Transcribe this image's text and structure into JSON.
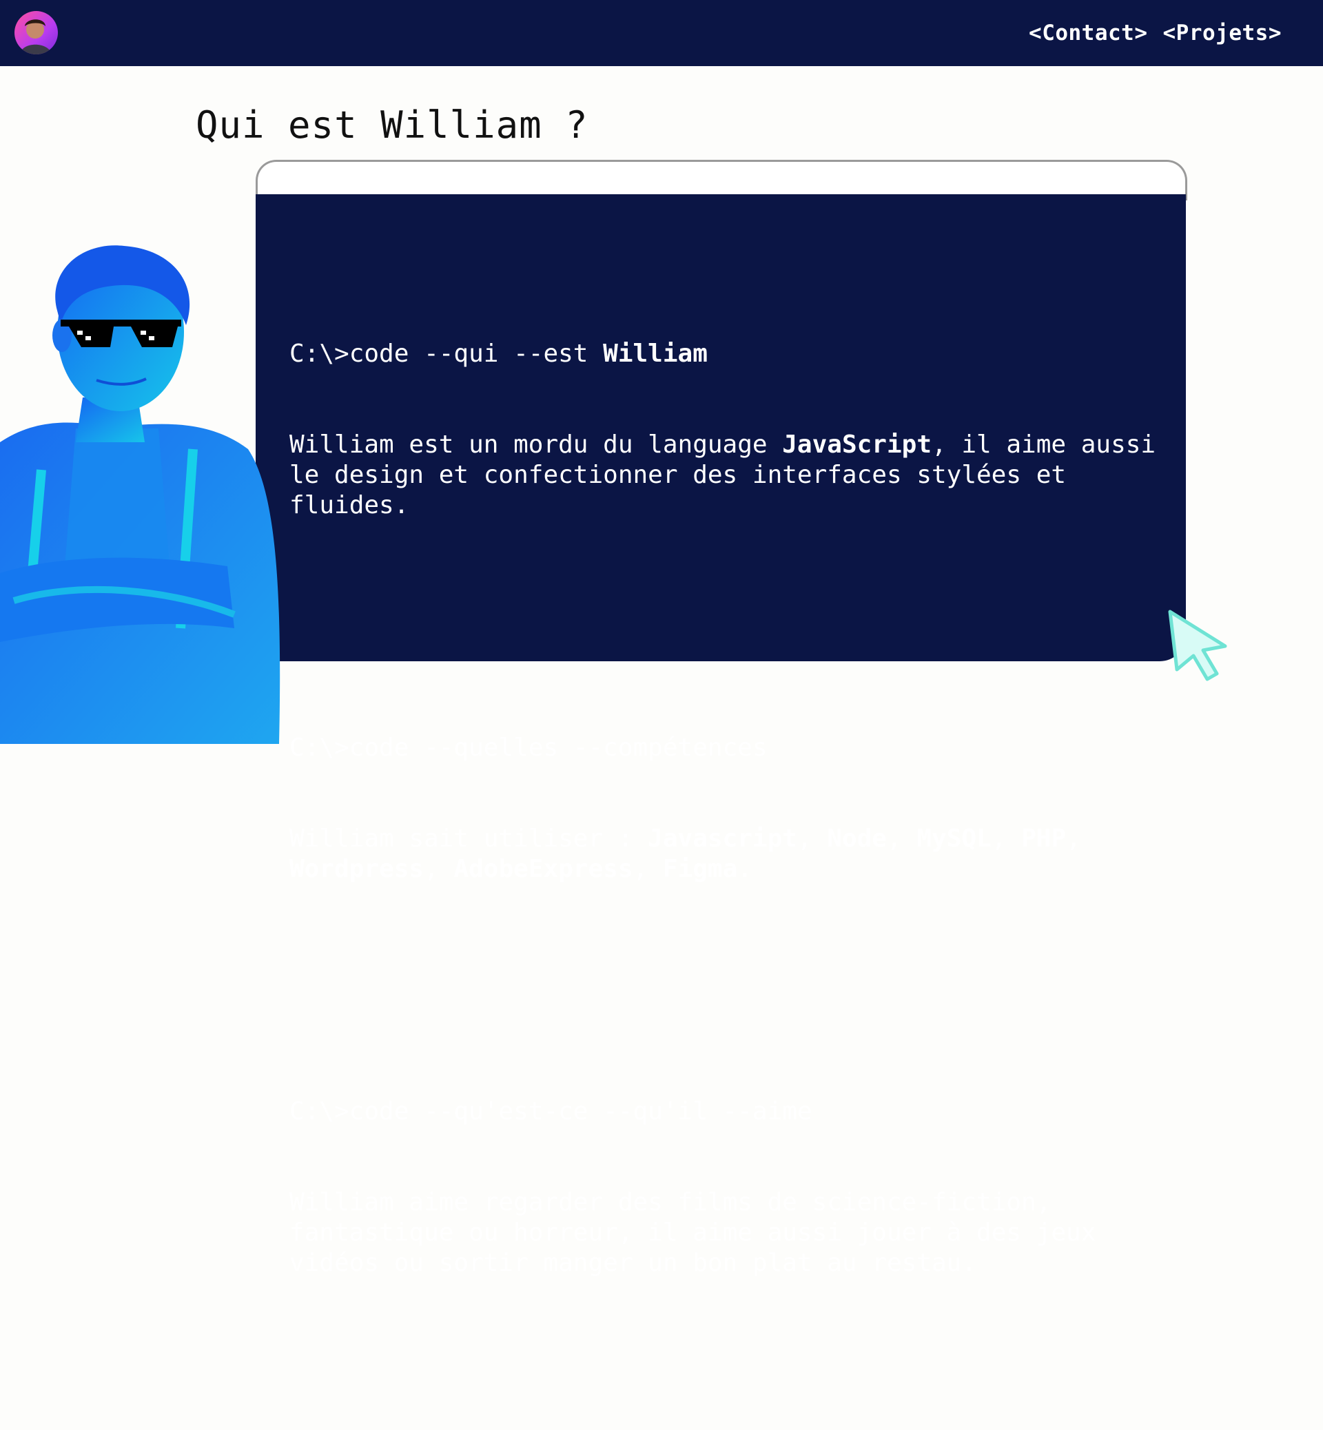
{
  "header": {
    "avatar_alt": "William",
    "nav": [
      {
        "label": "<Contact>"
      },
      {
        "label": "<Projets>"
      }
    ]
  },
  "page": {
    "title": "Qui est William ?"
  },
  "terminal": {
    "blocks": [
      {
        "cmd_prefix": "C:\\>code --qui --est ",
        "cmd_bold": "William",
        "output": [
          {
            "t": "William est un mordu du language ",
            "b": false
          },
          {
            "t": "JavaScript",
            "b": true
          },
          {
            "t": ", il aime aussi le design et confectionner des interfaces stylées et fluides.",
            "b": false
          }
        ]
      },
      {
        "cmd_prefix": "C:\\>code --quelles --compétences",
        "cmd_bold": "",
        "output": [
          {
            "t": "William sait utiliser : ",
            "b": false
          },
          {
            "t": "Javascript",
            "b": true
          },
          {
            "t": ", ",
            "b": false
          },
          {
            "t": "Node",
            "b": true
          },
          {
            "t": ", ",
            "b": false
          },
          {
            "t": "MySQL",
            "b": true
          },
          {
            "t": ", ",
            "b": false
          },
          {
            "t": "PHP",
            "b": true
          },
          {
            "t": ", ",
            "b": false
          },
          {
            "t": "Wordpress",
            "b": true
          },
          {
            "t": ", ",
            "b": false
          },
          {
            "t": "AdobeExpress",
            "b": true
          },
          {
            "t": ", ",
            "b": false
          },
          {
            "t": "Figma",
            "b": true
          },
          {
            "t": ".",
            "b": false
          }
        ]
      },
      {
        "cmd_prefix": "C:\\>code --qu'est-ce --qu'il --aime",
        "cmd_bold": "",
        "output": [
          {
            "t": "William aime regarder des films de science-fiction, fantastique ou horreur, il aime aussi jouer à des jeux vidéos ou sortir manger un bon plat au restau.",
            "b": false
          }
        ]
      }
    ]
  },
  "colors": {
    "navy": "#0b1545",
    "person_blue": "#1a55f0",
    "person_cyan": "#15c8e8",
    "cursor_fill": "#d8fbf6",
    "cursor_stroke": "#6fe3d4",
    "avatar_pink": "#ff4fa0"
  },
  "icons": {
    "avatar": "avatar-photo",
    "cursor": "mouse-pointer-icon",
    "glasses": "pixel-sunglasses-icon"
  }
}
